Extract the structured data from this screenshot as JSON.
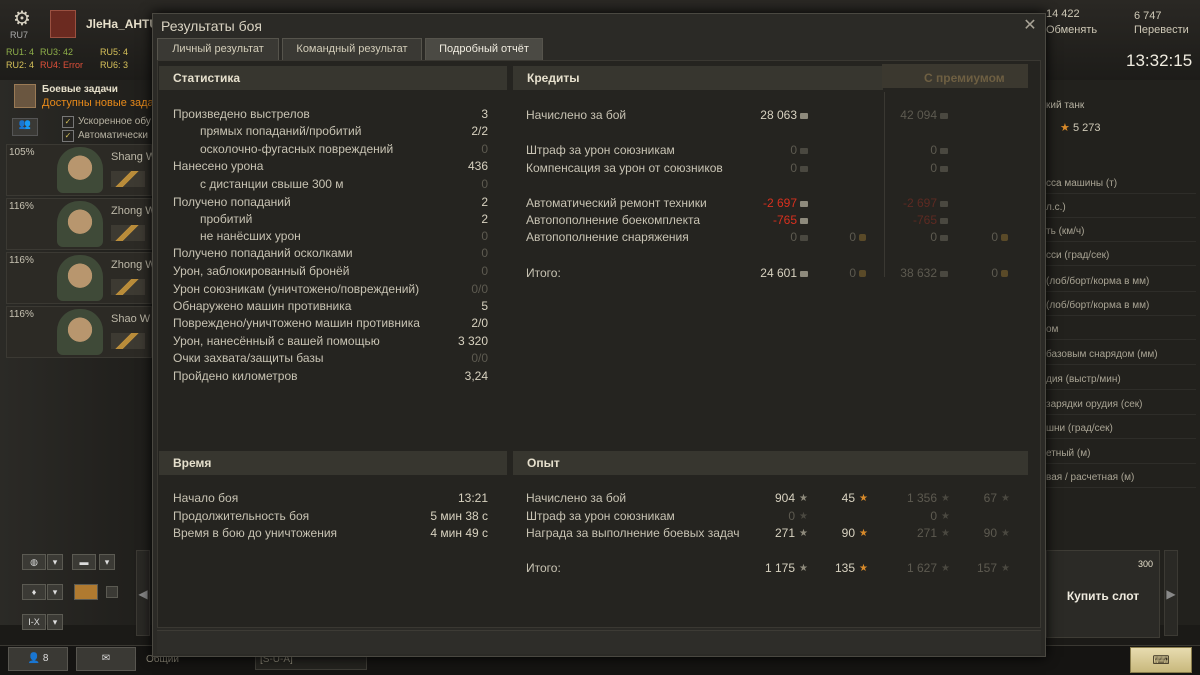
{
  "background": {
    "tier_label": "RU7",
    "player_name": "JleHa_AHTU",
    "servers": [
      {
        "label": "RU1: 4",
        "status": "ok"
      },
      {
        "label": "RU3: 42",
        "status": "ok"
      },
      {
        "label": "RU5: 4",
        "status": "mid"
      },
      {
        "label": "RU2: 4",
        "status": "mid"
      },
      {
        "label": "RU4: Error",
        "status": "err"
      },
      {
        "label": "RU6: 3",
        "status": "mid"
      }
    ],
    "tasks": {
      "title": "Боевые задачи",
      "subtitle": "Доступны новые задач"
    },
    "checkbox_a": "Ускоренное обу",
    "checkbox_b": "Автоматически",
    "crew": [
      {
        "pct": "105%",
        "name": "Shang W"
      },
      {
        "pct": "116%",
        "name": "Zhong W"
      },
      {
        "pct": "116%",
        "name": "Zhong W"
      },
      {
        "pct": "116%",
        "name": "Shao W"
      }
    ],
    "credits_top": "14 422",
    "gold_top": "6 747",
    "exchange_label": "Обменять",
    "convert_label": "Перевести",
    "clock": "13:32:15",
    "tank_label": "кий танк",
    "gold_right": "5 273",
    "params": [
      "сса машины (т)",
      "л.с.)",
      "ть (км/ч)",
      "сси (град/сек)",
      "(лоб/борт/корма в мм)",
      "(лоб/борт/корма в мм)",
      "ом",
      "базовым снарядом (мм)",
      "дия (выстр/мин)",
      "зарядки орудия (сек)",
      "шни (град/сек)",
      "етный (м)",
      "вая / расчетная (м)"
    ],
    "filter_roman": "I-X",
    "buy_price": "300",
    "buy_label": "Купить слот",
    "friends_count": "8",
    "chat_label": "Общий",
    "chat_channel": "[S-U-A]"
  },
  "modal": {
    "title": "Результаты боя",
    "tabs": [
      "Личный результат",
      "Командный результат",
      "Подробный отчёт"
    ],
    "active_tab": 2,
    "stats": {
      "header": "Статистика",
      "rows": [
        {
          "label": "Произведено выстрелов",
          "value": "3",
          "indent": false,
          "dim": false
        },
        {
          "label": "прямых попаданий/пробитий",
          "value": "2/2",
          "indent": true,
          "dim": false
        },
        {
          "label": "осколочно-фугасных повреждений",
          "value": "0",
          "indent": true,
          "dim": true
        },
        {
          "label": "Нанесено урона",
          "value": "436",
          "indent": false,
          "dim": false
        },
        {
          "label": "с дистанции свыше 300 м",
          "value": "0",
          "indent": true,
          "dim": true
        },
        {
          "label": "Получено попаданий",
          "value": "2",
          "indent": false,
          "dim": false
        },
        {
          "label": "пробитий",
          "value": "2",
          "indent": true,
          "dim": false
        },
        {
          "label": "не нанёсших урон",
          "value": "0",
          "indent": true,
          "dim": true
        },
        {
          "label": "Получено попаданий осколками",
          "value": "0",
          "indent": false,
          "dim": true
        },
        {
          "label": "Урон, заблокированный бронёй",
          "value": "0",
          "indent": false,
          "dim": true
        },
        {
          "label": "Урон союзникам (уничтожено/повреждений)",
          "value": "0/0",
          "indent": false,
          "dim": true
        },
        {
          "label": "Обнаружено машин противника",
          "value": "5",
          "indent": false,
          "dim": false
        },
        {
          "label": "Повреждено/уничтожено машин противника",
          "value": "2/0",
          "indent": false,
          "dim": false
        },
        {
          "label": "Урон, нанесённый с вашей помощью",
          "value": "3 320",
          "indent": false,
          "dim": false
        },
        {
          "label": "Очки захвата/защиты базы",
          "value": "0/0",
          "indent": false,
          "dim": true
        },
        {
          "label": "Пройдено километров",
          "value": "3,24",
          "indent": false,
          "dim": false
        }
      ]
    },
    "credits": {
      "header": "Кредиты",
      "premium_header": "С премиумом",
      "rows": [
        {
          "label": "Начислено за бой",
          "base": "28 063",
          "base_gold": "",
          "prem": "42 094",
          "prem_gold": "",
          "type": "normal"
        },
        {
          "label": "Штраф за урон союзникам",
          "base": "0",
          "base_gold": "",
          "prem": "0",
          "prem_gold": "",
          "type": "dim"
        },
        {
          "label": "Компенсация за урон от союзников",
          "base": "0",
          "base_gold": "",
          "prem": "0",
          "prem_gold": "",
          "type": "dim"
        },
        {
          "label": "Автоматический ремонт техники",
          "base": "-2 697",
          "base_gold": "",
          "prem": "-2 697",
          "prem_gold": "",
          "type": "red"
        },
        {
          "label": "Автопополнение боекомплекта",
          "base": "-765",
          "base_gold": "",
          "prem": "-765",
          "prem_gold": "",
          "type": "red"
        },
        {
          "label": "Автопополнение снаряжения",
          "base": "0",
          "base_gold": "0",
          "prem": "0",
          "prem_gold": "0",
          "type": "dim"
        },
        {
          "label": "Итого:",
          "base": "24 601",
          "base_gold": "0",
          "prem": "38 632",
          "prem_gold": "0",
          "type": "total"
        }
      ]
    },
    "time": {
      "header": "Время",
      "rows": [
        {
          "label": "Начало боя",
          "value": "13:21"
        },
        {
          "label": "Продолжительность боя",
          "value": "5 мин 38 с"
        },
        {
          "label": "Время в бою до уничтожения",
          "value": "4 мин 49 с"
        }
      ]
    },
    "xp": {
      "header": "Опыт",
      "rows": [
        {
          "label": "Начислено за бой",
          "xp": "904",
          "free": "45",
          "prem_xp": "1 356",
          "prem_free": "67",
          "dim": false
        },
        {
          "label": "Штраф за урон союзникам",
          "xp": "0",
          "free": "",
          "prem_xp": "0",
          "prem_free": "",
          "dim": true
        },
        {
          "label": "Награда за выполнение боевых задач",
          "xp": "271",
          "free": "90",
          "prem_xp": "271",
          "prem_free": "90",
          "dim": false
        },
        {
          "label": "Итого:",
          "xp": "1 175",
          "free": "135",
          "prem_xp": "1 627",
          "prem_free": "157",
          "dim": false
        }
      ]
    }
  }
}
